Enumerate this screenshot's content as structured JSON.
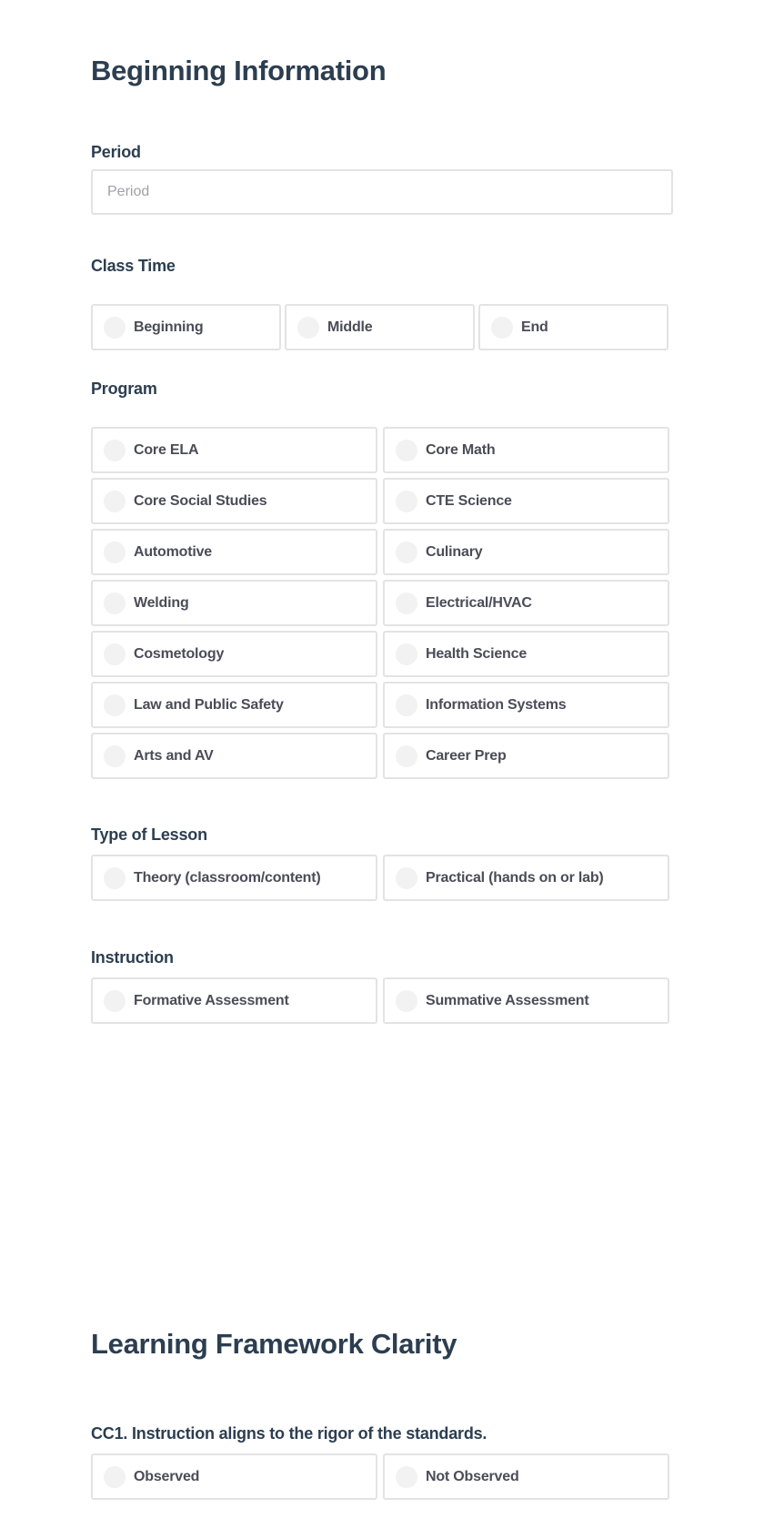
{
  "sections": {
    "beginning": {
      "title": "Beginning Information",
      "period": {
        "label": "Period",
        "placeholder": "Period",
        "value": ""
      },
      "class_time": {
        "label": "Class Time",
        "options": [
          "Beginning",
          "Middle",
          "End"
        ]
      },
      "program": {
        "label": "Program",
        "options": [
          "Core ELA",
          "Core Math",
          "Core Social Studies",
          "CTE Science",
          "Automotive",
          "Culinary",
          "Welding",
          "Electrical/HVAC",
          "Cosmetology",
          "Health Science",
          "Law and Public Safety",
          "Information Systems",
          "Arts and AV",
          "Career Prep"
        ]
      },
      "type_of_lesson": {
        "label": "Type of Lesson",
        "options": [
          "Theory (classroom/content)",
          "Practical (hands on or lab)"
        ]
      },
      "instruction": {
        "label": "Instruction",
        "options": [
          "Formative Assessment",
          "Summative Assessment"
        ]
      }
    },
    "framework": {
      "title": "Learning Framework Clarity",
      "cc1": {
        "label": "CC1. Instruction aligns to the rigor of the standards.",
        "options": [
          "Observed",
          "Not Observed"
        ]
      }
    }
  },
  "colors": {
    "heading": "#2c3e50",
    "option_text": "#4a4d57",
    "border": "#e3e3e3",
    "radio_fill": "#f2f2f3",
    "placeholder": "#a0a0a8"
  }
}
